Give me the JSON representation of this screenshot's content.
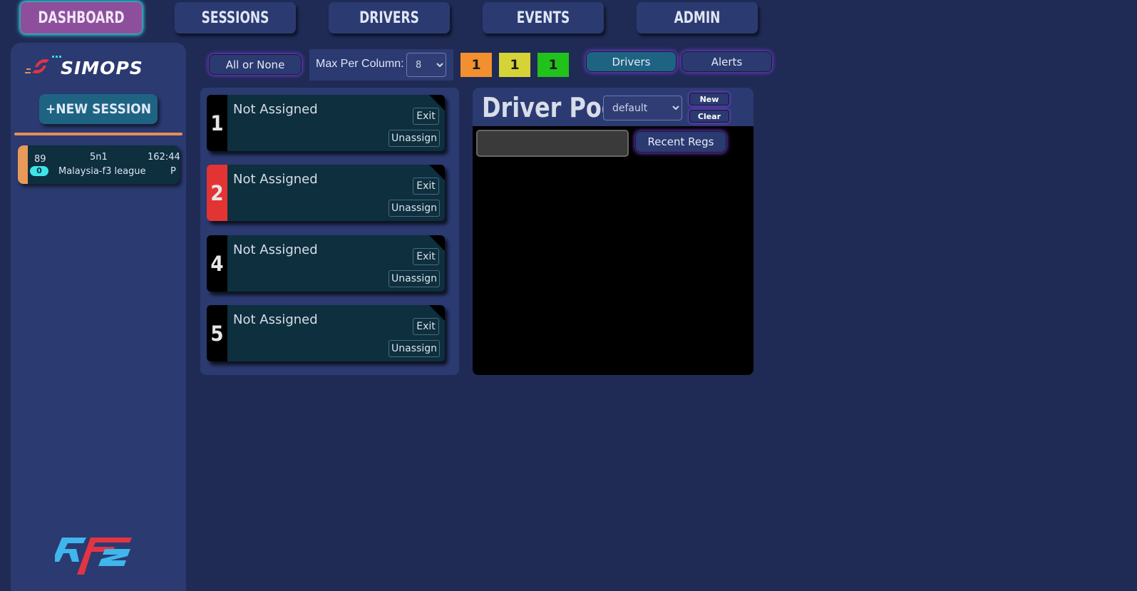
{
  "nav": {
    "items": [
      {
        "label": "DASHBOARD",
        "active": true
      },
      {
        "label": "SESSIONS",
        "active": false
      },
      {
        "label": "DRIVERS",
        "active": false
      },
      {
        "label": "EVENTS",
        "active": false
      },
      {
        "label": "ADMIN",
        "active": false
      }
    ]
  },
  "sidebar": {
    "logo_text": "SIMOPS",
    "new_session_label": "+NEW SESSION",
    "session": {
      "id": "89",
      "badge": "0",
      "format": "5n1",
      "time": "162:44",
      "name": "Malaysia-f3 league",
      "status": "P"
    },
    "footer_logo": "rF2"
  },
  "controls": {
    "all_or_none_label": "All or None",
    "max_per_column_label": "Max Per Column:",
    "max_per_column_value": "8",
    "counts": [
      {
        "value": "1",
        "color": "#f28f2f"
      },
      {
        "value": "1",
        "color": "#d6d336"
      },
      {
        "value": "1",
        "color": "#21c21b"
      }
    ],
    "drivers_tab_label": "Drivers",
    "alerts_tab_label": "Alerts"
  },
  "seats": [
    {
      "number": "1",
      "name": "Not Assigned",
      "exit_label": "Exit",
      "unassign_label": "Unassign",
      "alert": false
    },
    {
      "number": "2",
      "name": "Not Assigned",
      "exit_label": "Exit",
      "unassign_label": "Unassign",
      "alert": true
    },
    {
      "number": "4",
      "name": "Not Assigned",
      "exit_label": "Exit",
      "unassign_label": "Unassign",
      "alert": false
    },
    {
      "number": "5",
      "name": "Not Assigned",
      "exit_label": "Exit",
      "unassign_label": "Unassign",
      "alert": false
    }
  ],
  "driver_pool": {
    "title": "Driver Pool",
    "selected_pool": "default",
    "new_label": "New",
    "clear_label": "Clear",
    "search_value": "",
    "recent_regs_label": "Recent Regs"
  },
  "colors": {
    "background": "#1f2b55",
    "panel": "#2b3a70",
    "card": "#0d2f3e",
    "active_nav": "#8d4f9c",
    "glow_cyan": "#3fe4e8",
    "glow_purple": "#7b3bd6",
    "alert_red": "#e33434",
    "session_stripe": "#e89a58"
  }
}
